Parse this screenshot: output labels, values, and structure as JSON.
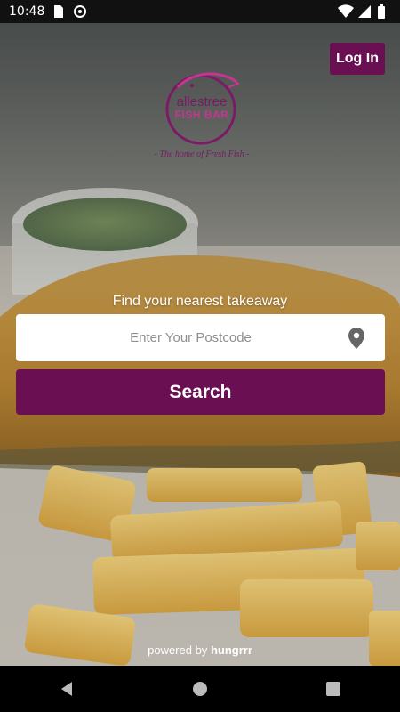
{
  "status_bar": {
    "time": "10:48",
    "left_icons": [
      "sd-card-icon",
      "sync-icon"
    ],
    "right_icons": [
      "wifi-icon",
      "cellular-icon",
      "battery-icon"
    ]
  },
  "header": {
    "login_label": "Log In"
  },
  "brand": {
    "name_line1": "allestree",
    "name_line2": "FISH BAR",
    "tagline": "- The home of Fresh Fish -"
  },
  "search": {
    "prompt": "Find your nearest takeaway",
    "postcode_value": "",
    "postcode_placeholder": "Enter Your Postcode",
    "location_icon": "location-pin-icon",
    "button_label": "Search"
  },
  "footer": {
    "powered_prefix": "powered by",
    "powered_brand": "hungrrr"
  },
  "nav": {
    "icons": [
      "back-icon",
      "home-icon",
      "recents-icon"
    ]
  },
  "colors": {
    "accent": "#6b0f53",
    "logo_purple": "#7b1a66",
    "logo_pink": "#c4368f"
  }
}
